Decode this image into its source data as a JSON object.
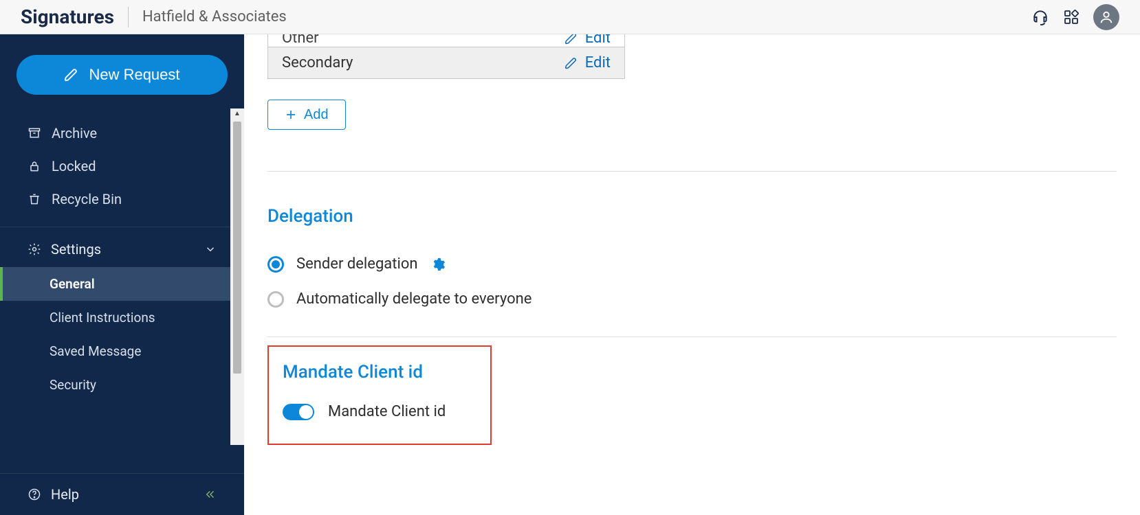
{
  "header": {
    "brand": "Signatures",
    "org": "Hatfield & Associates"
  },
  "sidebar": {
    "new_request": "New Request",
    "items": [
      {
        "label": "Archive"
      },
      {
        "label": "Locked"
      },
      {
        "label": "Recycle Bin"
      }
    ],
    "settings_label": "Settings",
    "sub_items": [
      {
        "label": "General",
        "active": true
      },
      {
        "label": "Client Instructions"
      },
      {
        "label": "Saved Message"
      },
      {
        "label": "Security"
      }
    ],
    "help_label": "Help"
  },
  "address_table": {
    "rows": [
      {
        "label": "Other",
        "edit": "Edit"
      },
      {
        "label": "Secondary",
        "edit": "Edit"
      }
    ],
    "add_label": "Add"
  },
  "delegation": {
    "title": "Delegation",
    "opt1": "Sender delegation",
    "opt2": "Automatically delegate to everyone"
  },
  "mandate": {
    "title": "Mandate Client id",
    "toggle_label": "Mandate Client id",
    "toggle_on": true
  }
}
